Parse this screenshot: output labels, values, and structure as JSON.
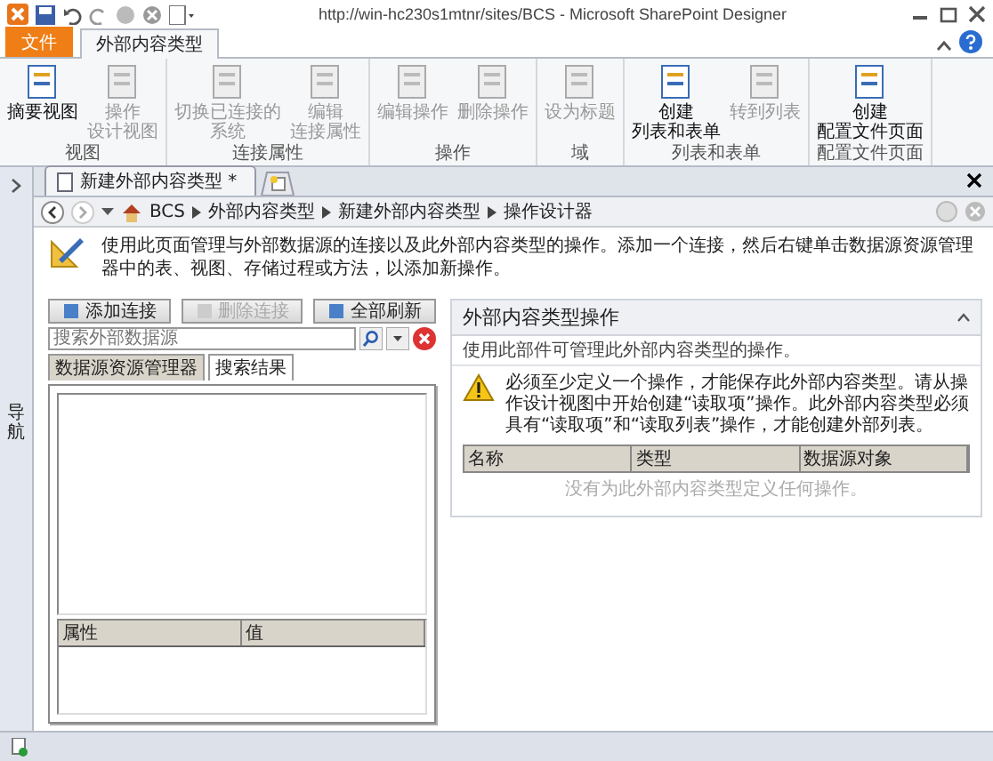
{
  "window": {
    "title": "http://win-hc230s1mtnr/sites/BCS  -  Microsoft SharePoint Designer"
  },
  "ribbon": {
    "tabs": [
      {
        "label": "文件",
        "kind": "file",
        "selected": false
      },
      {
        "label": "外部内容类型",
        "kind": "tab",
        "selected": true
      }
    ],
    "groups": [
      {
        "label": "视图",
        "buttons": [
          {
            "lines": [
              "摘要视图"
            ],
            "disabled": false
          },
          {
            "lines": [
              "操作",
              "设计视图"
            ],
            "disabled": true
          }
        ]
      },
      {
        "label": "连接属性",
        "buttons": [
          {
            "lines": [
              "切换已连接的",
              "系统"
            ],
            "disabled": true
          },
          {
            "lines": [
              "编辑",
              "连接属性"
            ],
            "disabled": true
          }
        ]
      },
      {
        "label": "操作",
        "buttons": [
          {
            "lines": [
              "编辑操作"
            ],
            "disabled": true
          },
          {
            "lines": [
              "删除操作"
            ],
            "disabled": true
          }
        ]
      },
      {
        "label": "域",
        "buttons": [
          {
            "lines": [
              "设为标题"
            ],
            "disabled": true
          }
        ]
      },
      {
        "label": "列表和表单",
        "buttons": [
          {
            "lines": [
              "创建",
              "列表和表单"
            ],
            "disabled": false
          },
          {
            "lines": [
              "转到列表"
            ],
            "disabled": true
          }
        ]
      },
      {
        "label": "配置文件页面",
        "buttons": [
          {
            "lines": [
              "创建",
              "配置文件页面"
            ],
            "disabled": false
          }
        ]
      }
    ]
  },
  "navigation_pane": {
    "label": "导航"
  },
  "document_tab": {
    "label": "新建外部内容类型 *"
  },
  "breadcrumb": [
    "BCS",
    "外部内容类型",
    "新建外部内容类型",
    "操作设计器"
  ],
  "description": "使用此页面管理与外部数据源的连接以及此外部内容类型的操作。添加一个连接，然后右键单击数据源资源管理器中的表、视图、存储过程或方法，以添加新操作。",
  "left_panel": {
    "buttons": [
      {
        "label": "添加连接",
        "disabled": false
      },
      {
        "label": "删除连接",
        "disabled": true
      },
      {
        "label": "全部刷新",
        "disabled": false
      }
    ],
    "search": {
      "placeholder": "搜索外部数据源"
    },
    "tabs": [
      {
        "label": "数据源资源管理器",
        "selected": true
      },
      {
        "label": "搜索结果",
        "selected": false
      }
    ],
    "properties_columns": [
      "属性",
      "值"
    ]
  },
  "right_panel": {
    "title": "外部内容类型操作",
    "subtitle": "使用此部件可管理此外部内容类型的操作。",
    "warning": "必须至少定义一个操作，才能保存此外部内容类型。请从操作设计视图中开始创建“读取项”操作。此外部内容类型必须具有“读取项”和“读取列表”操作，才能创建外部列表。",
    "columns": [
      "名称",
      "类型",
      "数据源对象"
    ],
    "empty_message": "没有为此外部内容类型定义任何操作。"
  }
}
